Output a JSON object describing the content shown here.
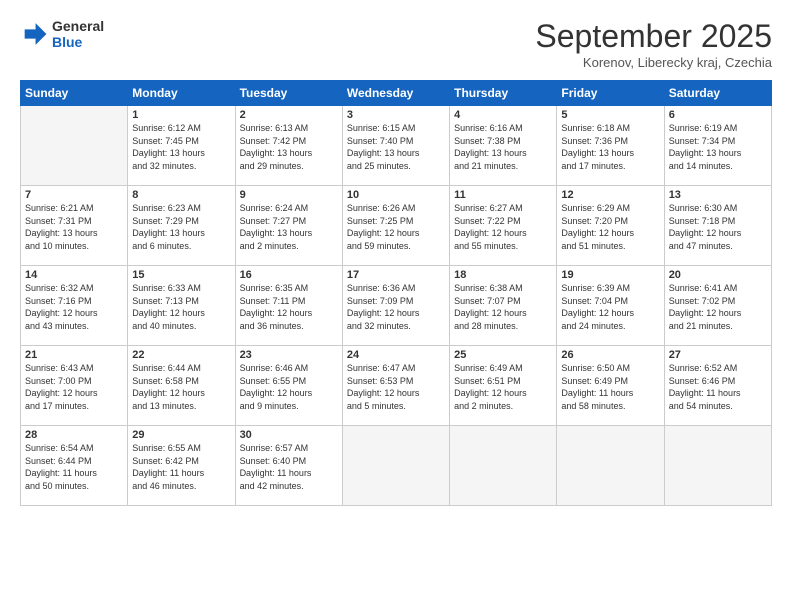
{
  "logo": {
    "line1": "General",
    "line2": "Blue"
  },
  "title": "September 2025",
  "location": "Korenov, Liberecky kraj, Czechia",
  "weekdays": [
    "Sunday",
    "Monday",
    "Tuesday",
    "Wednesday",
    "Thursday",
    "Friday",
    "Saturday"
  ],
  "weeks": [
    [
      {
        "day": "",
        "info": ""
      },
      {
        "day": "1",
        "info": "Sunrise: 6:12 AM\nSunset: 7:45 PM\nDaylight: 13 hours\nand 32 minutes."
      },
      {
        "day": "2",
        "info": "Sunrise: 6:13 AM\nSunset: 7:42 PM\nDaylight: 13 hours\nand 29 minutes."
      },
      {
        "day": "3",
        "info": "Sunrise: 6:15 AM\nSunset: 7:40 PM\nDaylight: 13 hours\nand 25 minutes."
      },
      {
        "day": "4",
        "info": "Sunrise: 6:16 AM\nSunset: 7:38 PM\nDaylight: 13 hours\nand 21 minutes."
      },
      {
        "day": "5",
        "info": "Sunrise: 6:18 AM\nSunset: 7:36 PM\nDaylight: 13 hours\nand 17 minutes."
      },
      {
        "day": "6",
        "info": "Sunrise: 6:19 AM\nSunset: 7:34 PM\nDaylight: 13 hours\nand 14 minutes."
      }
    ],
    [
      {
        "day": "7",
        "info": "Sunrise: 6:21 AM\nSunset: 7:31 PM\nDaylight: 13 hours\nand 10 minutes."
      },
      {
        "day": "8",
        "info": "Sunrise: 6:23 AM\nSunset: 7:29 PM\nDaylight: 13 hours\nand 6 minutes."
      },
      {
        "day": "9",
        "info": "Sunrise: 6:24 AM\nSunset: 7:27 PM\nDaylight: 13 hours\nand 2 minutes."
      },
      {
        "day": "10",
        "info": "Sunrise: 6:26 AM\nSunset: 7:25 PM\nDaylight: 12 hours\nand 59 minutes."
      },
      {
        "day": "11",
        "info": "Sunrise: 6:27 AM\nSunset: 7:22 PM\nDaylight: 12 hours\nand 55 minutes."
      },
      {
        "day": "12",
        "info": "Sunrise: 6:29 AM\nSunset: 7:20 PM\nDaylight: 12 hours\nand 51 minutes."
      },
      {
        "day": "13",
        "info": "Sunrise: 6:30 AM\nSunset: 7:18 PM\nDaylight: 12 hours\nand 47 minutes."
      }
    ],
    [
      {
        "day": "14",
        "info": "Sunrise: 6:32 AM\nSunset: 7:16 PM\nDaylight: 12 hours\nand 43 minutes."
      },
      {
        "day": "15",
        "info": "Sunrise: 6:33 AM\nSunset: 7:13 PM\nDaylight: 12 hours\nand 40 minutes."
      },
      {
        "day": "16",
        "info": "Sunrise: 6:35 AM\nSunset: 7:11 PM\nDaylight: 12 hours\nand 36 minutes."
      },
      {
        "day": "17",
        "info": "Sunrise: 6:36 AM\nSunset: 7:09 PM\nDaylight: 12 hours\nand 32 minutes."
      },
      {
        "day": "18",
        "info": "Sunrise: 6:38 AM\nSunset: 7:07 PM\nDaylight: 12 hours\nand 28 minutes."
      },
      {
        "day": "19",
        "info": "Sunrise: 6:39 AM\nSunset: 7:04 PM\nDaylight: 12 hours\nand 24 minutes."
      },
      {
        "day": "20",
        "info": "Sunrise: 6:41 AM\nSunset: 7:02 PM\nDaylight: 12 hours\nand 21 minutes."
      }
    ],
    [
      {
        "day": "21",
        "info": "Sunrise: 6:43 AM\nSunset: 7:00 PM\nDaylight: 12 hours\nand 17 minutes."
      },
      {
        "day": "22",
        "info": "Sunrise: 6:44 AM\nSunset: 6:58 PM\nDaylight: 12 hours\nand 13 minutes."
      },
      {
        "day": "23",
        "info": "Sunrise: 6:46 AM\nSunset: 6:55 PM\nDaylight: 12 hours\nand 9 minutes."
      },
      {
        "day": "24",
        "info": "Sunrise: 6:47 AM\nSunset: 6:53 PM\nDaylight: 12 hours\nand 5 minutes."
      },
      {
        "day": "25",
        "info": "Sunrise: 6:49 AM\nSunset: 6:51 PM\nDaylight: 12 hours\nand 2 minutes."
      },
      {
        "day": "26",
        "info": "Sunrise: 6:50 AM\nSunset: 6:49 PM\nDaylight: 11 hours\nand 58 minutes."
      },
      {
        "day": "27",
        "info": "Sunrise: 6:52 AM\nSunset: 6:46 PM\nDaylight: 11 hours\nand 54 minutes."
      }
    ],
    [
      {
        "day": "28",
        "info": "Sunrise: 6:54 AM\nSunset: 6:44 PM\nDaylight: 11 hours\nand 50 minutes."
      },
      {
        "day": "29",
        "info": "Sunrise: 6:55 AM\nSunset: 6:42 PM\nDaylight: 11 hours\nand 46 minutes."
      },
      {
        "day": "30",
        "info": "Sunrise: 6:57 AM\nSunset: 6:40 PM\nDaylight: 11 hours\nand 42 minutes."
      },
      {
        "day": "",
        "info": ""
      },
      {
        "day": "",
        "info": ""
      },
      {
        "day": "",
        "info": ""
      },
      {
        "day": "",
        "info": ""
      }
    ]
  ]
}
